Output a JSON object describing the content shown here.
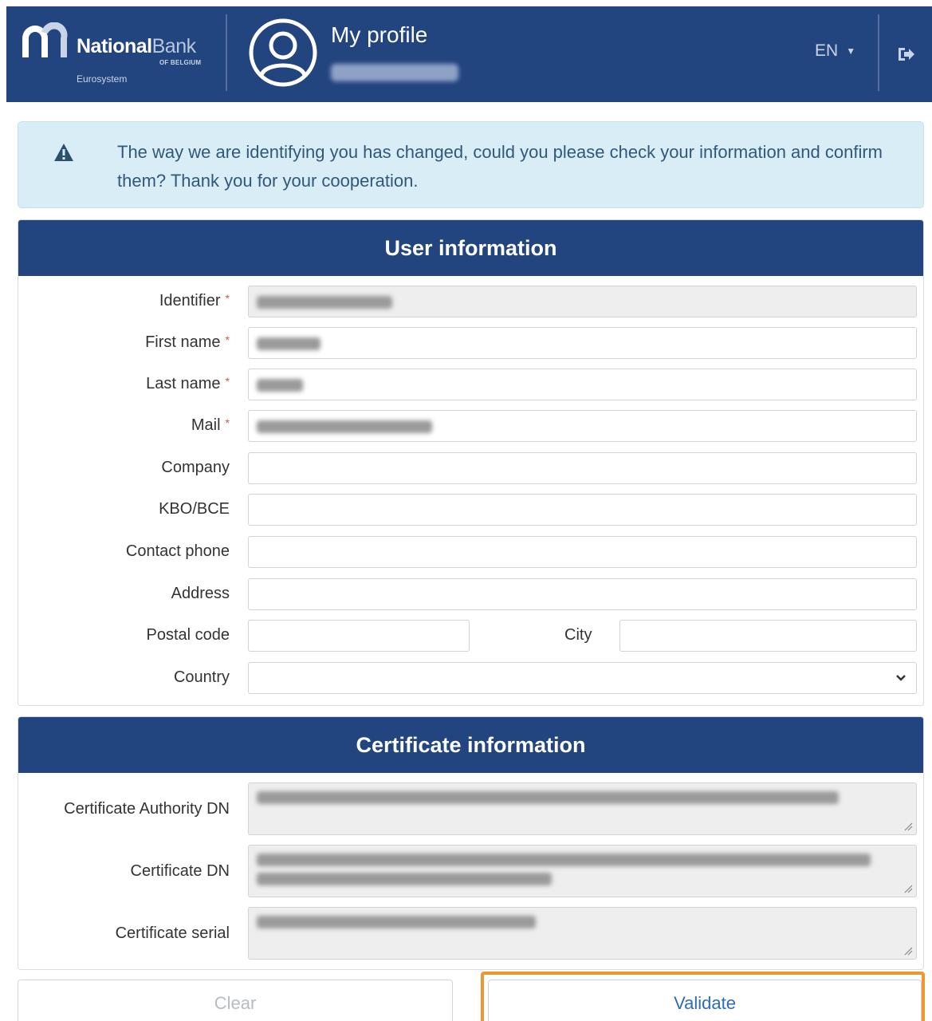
{
  "header": {
    "brand_bold": "National",
    "brand_light": "Bank",
    "brand_sub": "OF BELGIUM",
    "brand_euro": "Eurosystem",
    "title": "My profile",
    "language": "EN",
    "icons": {
      "avatar": "user-circle-icon",
      "logout": "sign-out-icon",
      "lang_caret": "caret-down-icon"
    }
  },
  "alert": {
    "icon": "warning-icon",
    "text": "The way we are identifying you has changed, could you please check your information and confirm them? Thank you for your cooperation."
  },
  "user_info": {
    "heading": "User information",
    "fields": {
      "identifier": "Identifier",
      "first_name": "First name",
      "last_name": "Last name",
      "mail": "Mail",
      "company": "Company",
      "kbo": "KBO/BCE",
      "phone": "Contact phone",
      "address": "Address",
      "postal_code": "Postal code",
      "city": "City",
      "country": "Country"
    },
    "required_mark": "*"
  },
  "certificate_info": {
    "heading": "Certificate information",
    "fields": {
      "authority_dn": "Certificate Authority DN",
      "dn": "Certificate DN",
      "serial": "Certificate serial"
    }
  },
  "buttons": {
    "clear": "Clear",
    "validate": "Validate"
  },
  "colors": {
    "header_bg": "#22447f",
    "alert_bg": "#d9edf7",
    "highlight": "#f0962f",
    "required": "#d9534f"
  }
}
